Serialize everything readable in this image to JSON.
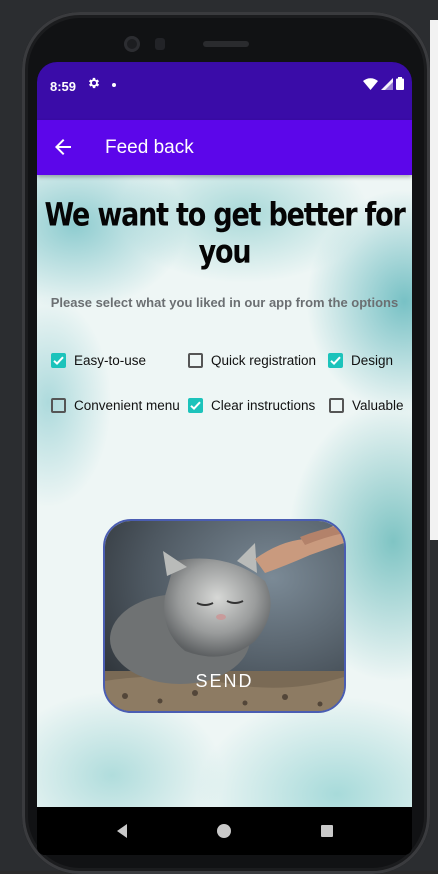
{
  "status_bar": {
    "time": "8:59",
    "icons": [
      "gear-icon",
      "dot-icon",
      "wifi-icon",
      "signal-icon",
      "battery-icon"
    ]
  },
  "app_bar": {
    "title": "Feed back",
    "back_icon": "arrow-left-icon",
    "color": "#5c06ea"
  },
  "content": {
    "headline": "We want to get better for you",
    "subtitle": "Please select what you liked in our app from the options",
    "options": [
      {
        "label": "Easy-to-use",
        "checked": true
      },
      {
        "label": "Quick registration",
        "checked": false
      },
      {
        "label": "Design",
        "checked": true
      },
      {
        "label": "Convenient menu",
        "checked": false
      },
      {
        "label": "Clear instructions",
        "checked": true
      },
      {
        "label": "Valuable",
        "checked": false
      }
    ],
    "send_button": {
      "label": "SEND",
      "image": "cat-being-petted-photo"
    }
  },
  "colors": {
    "status_bar": "#3a0ca8",
    "app_bar": "#5c06ea",
    "checkbox_accent": "#1cc3bb"
  },
  "nav_bar": {
    "icons": [
      "back-triangle-icon",
      "home-circle-icon",
      "recents-square-icon"
    ]
  }
}
